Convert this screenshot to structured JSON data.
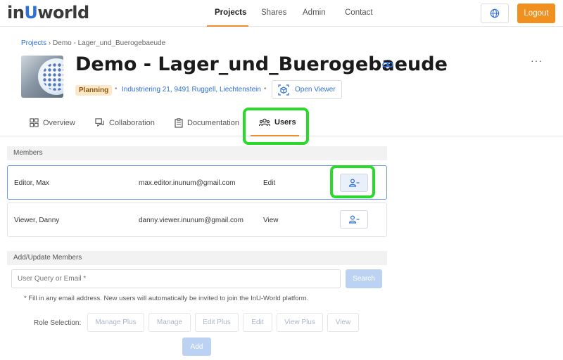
{
  "brand": {
    "logo_prefix": "in",
    "logo_accent": "U",
    "logo_suffix": "world"
  },
  "nav": {
    "items": [
      {
        "label": "Projects",
        "active": true
      },
      {
        "label": "Shares",
        "active": false
      },
      {
        "label": "Admin",
        "active": false
      },
      {
        "label": "Contact",
        "active": false
      }
    ],
    "globe_icon": "globe-icon",
    "logout_label": "Logout",
    "accent_color": "#f0901e"
  },
  "breadcrumb": {
    "root": "Projects",
    "separator": "›",
    "current": "Demo - Lager_und_Buerogebaeude"
  },
  "project": {
    "title": "Demo - Lager_und_Buerogebaeude",
    "status": "Planning",
    "address": "Industriering 21, 9491 Ruggell, Liechtenstein",
    "open_viewer_label": "Open Viewer",
    "more_label": "···"
  },
  "tabs": [
    {
      "label": "Overview",
      "icon": "grid-icon",
      "active": false
    },
    {
      "label": "Collaboration",
      "icon": "chat-icon",
      "active": false
    },
    {
      "label": "Documentation",
      "icon": "clipboard-icon",
      "active": false
    },
    {
      "label": "Users",
      "icon": "users-icon",
      "active": true
    }
  ],
  "members": {
    "header": "Members",
    "rows": [
      {
        "name": "Editor, Max",
        "email": "max.editor.inunum@gmail.com",
        "role": "Edit",
        "selected": true
      },
      {
        "name": "Viewer, Danny",
        "email": "danny.viewer.inunum@gmail.com",
        "role": "View",
        "selected": false
      }
    ]
  },
  "add_update": {
    "header": "Add/Update Members",
    "input_placeholder": "User Query or Email *",
    "search_label": "Search",
    "help_text": "* Fill in any email address. New users will automatically be invited to join the InU-World platform.",
    "role_selection_label": "Role Selection:",
    "roles": [
      "Manage Plus",
      "Manage",
      "Edit Plus",
      "Edit",
      "View Plus",
      "View"
    ],
    "add_label": "Add"
  },
  "highlight_color": "#2bd92b"
}
